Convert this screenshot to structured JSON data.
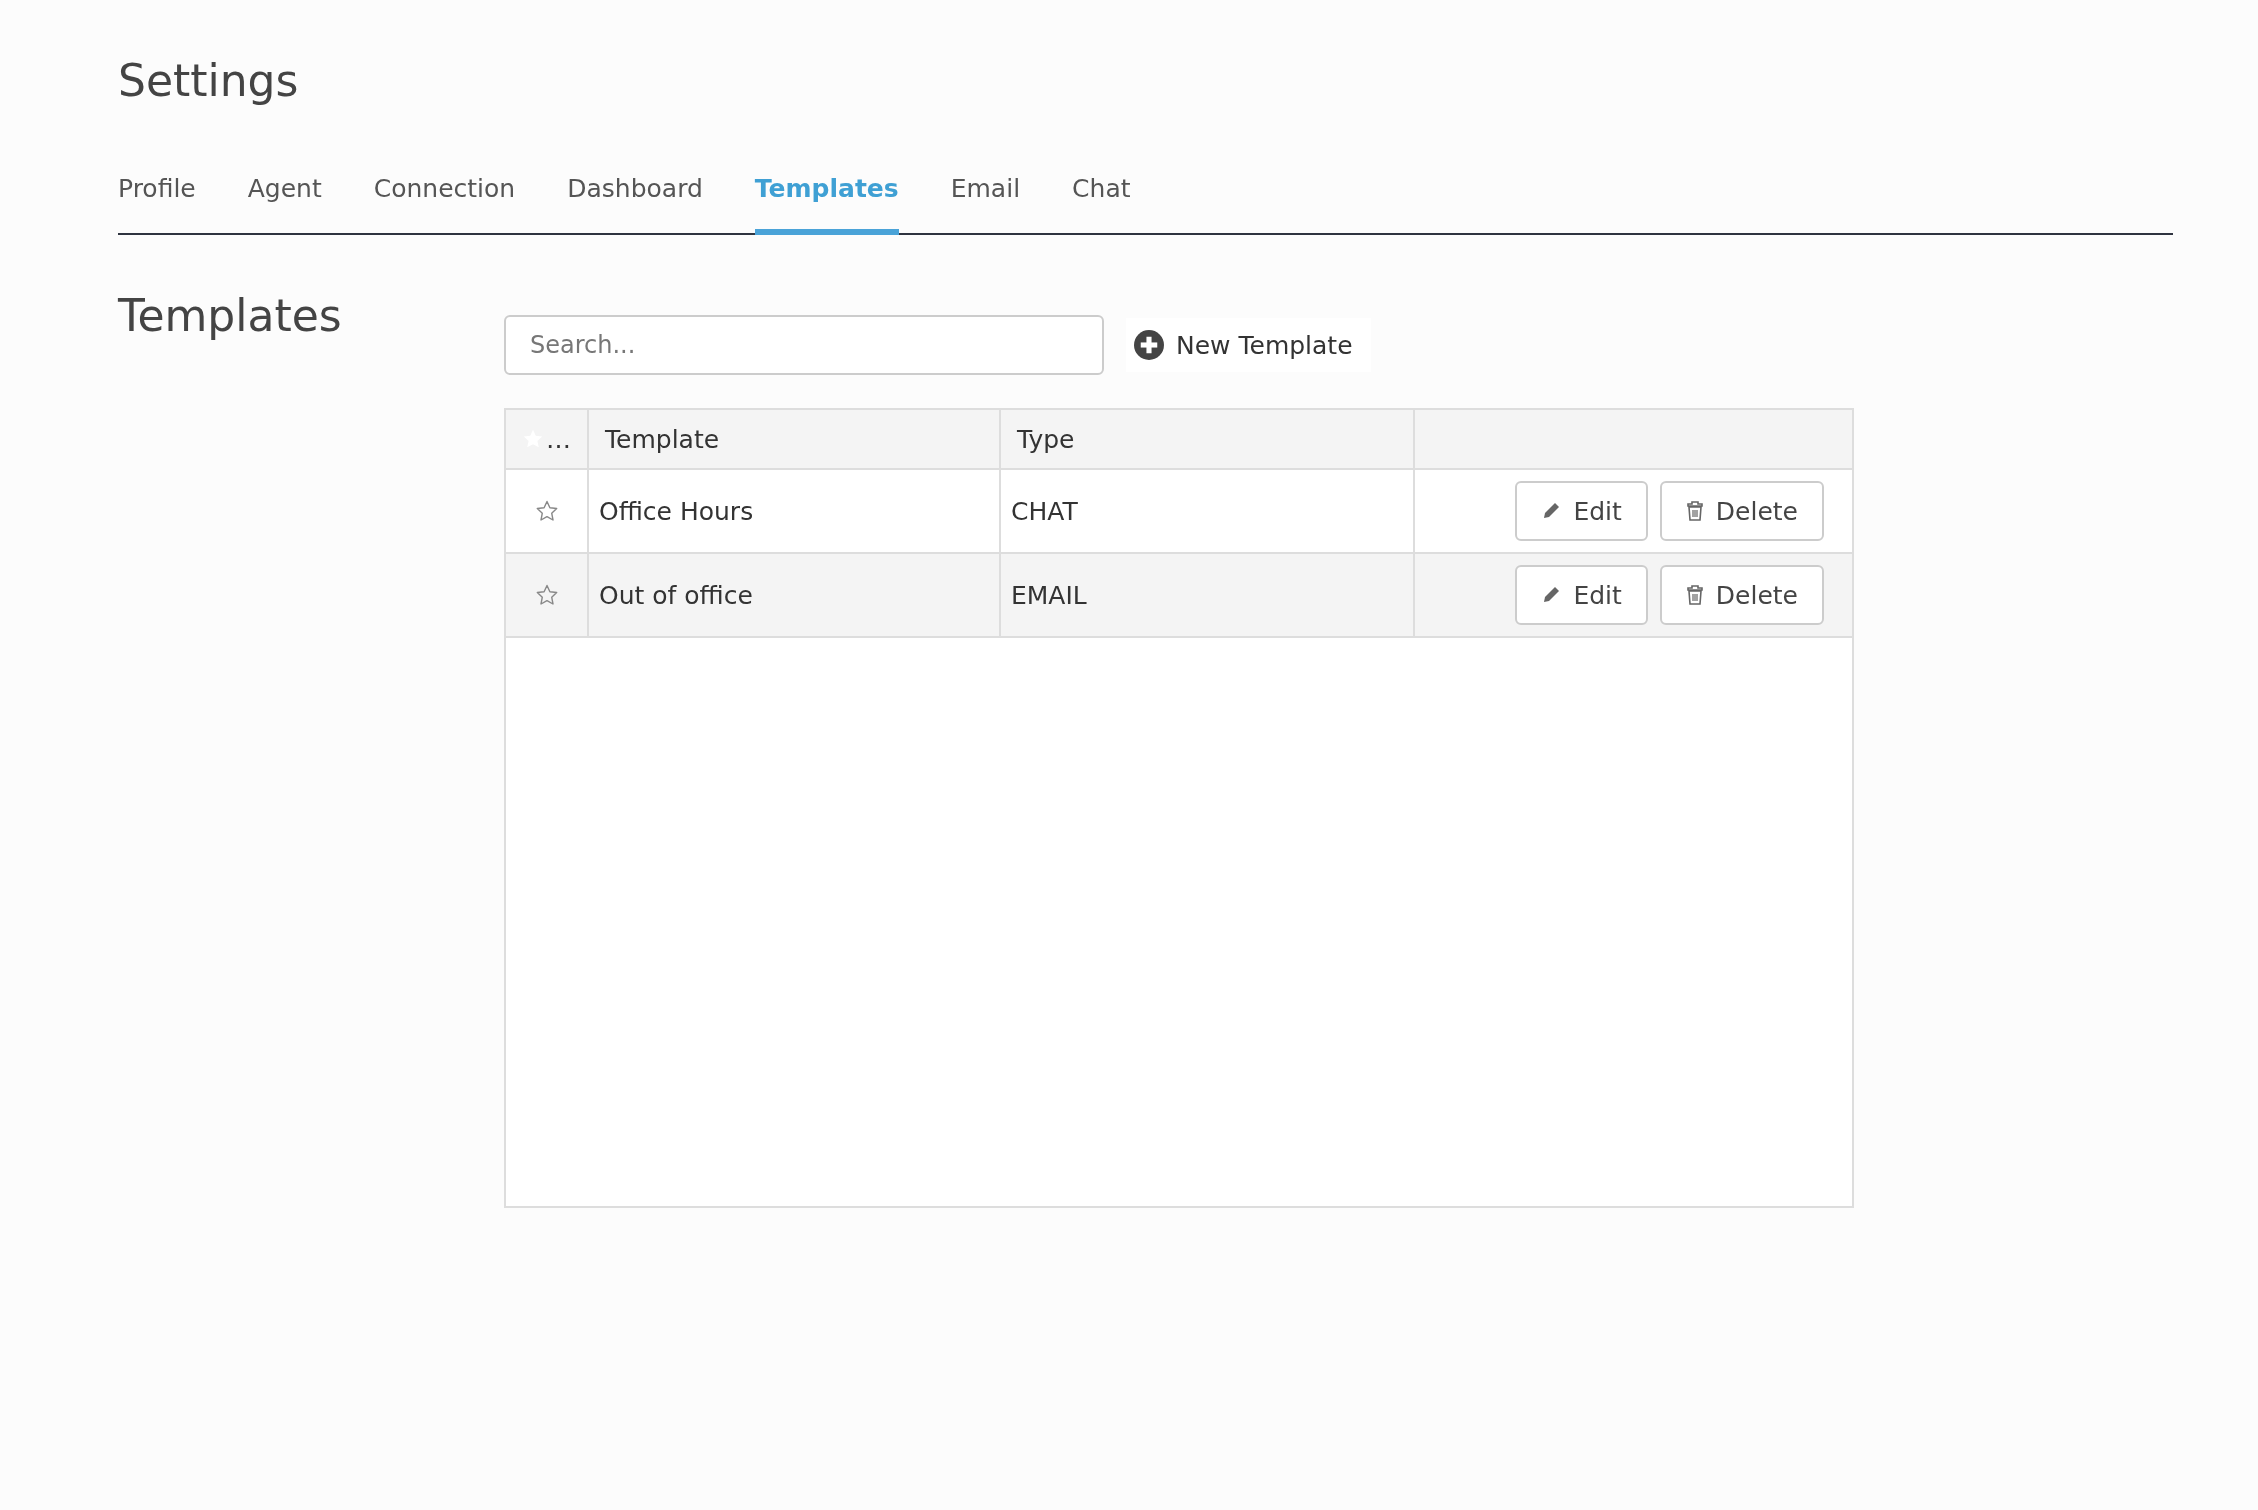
{
  "page_title": "Settings",
  "tabs": [
    {
      "label": "Profile",
      "selected": false
    },
    {
      "label": "Agent",
      "selected": false
    },
    {
      "label": "Connection",
      "selected": false
    },
    {
      "label": "Dashboard",
      "selected": false
    },
    {
      "label": "Templates",
      "selected": true
    },
    {
      "label": "Email",
      "selected": false
    },
    {
      "label": "Chat",
      "selected": false
    }
  ],
  "section_title": "Templates",
  "search": {
    "placeholder": "Search..."
  },
  "new_button": "New Template",
  "table": {
    "columns": [
      "…",
      "Template",
      "Type",
      ""
    ],
    "rows": [
      {
        "starred": false,
        "template": "Office Hours",
        "type": "CHAT",
        "actions": [
          "Edit",
          "Delete"
        ]
      },
      {
        "starred": false,
        "template": "Out of office",
        "type": "EMAIL",
        "actions": [
          "Edit",
          "Delete"
        ]
      }
    ]
  }
}
